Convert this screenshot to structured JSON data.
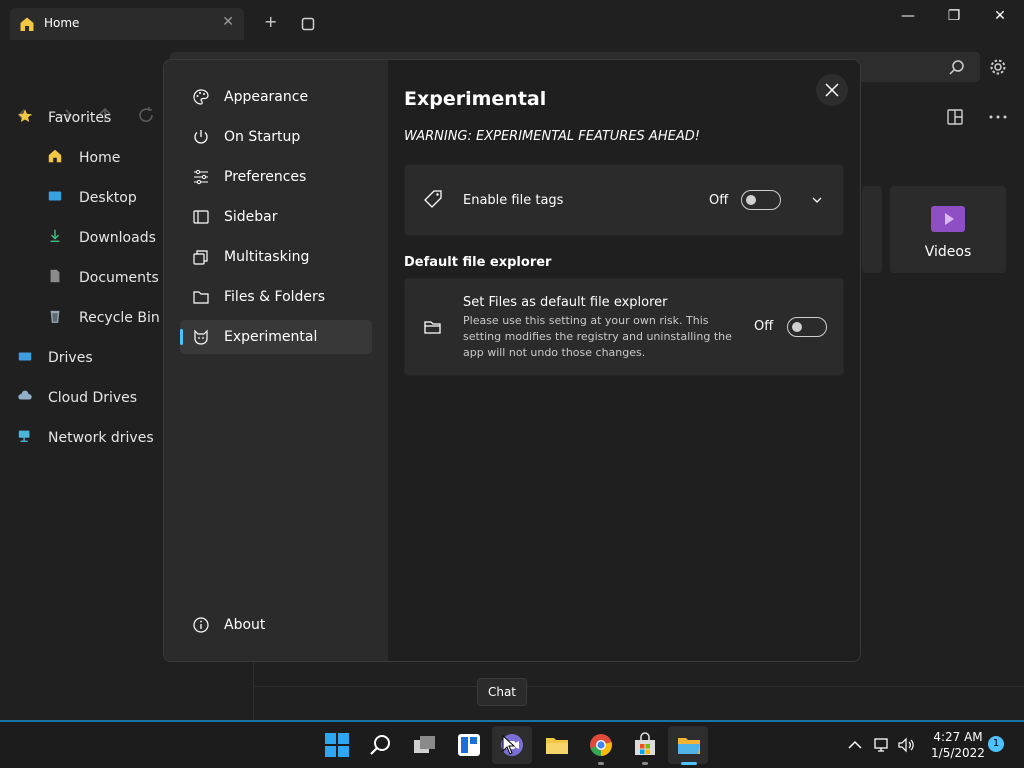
{
  "window": {
    "tab_title": "Home",
    "tab_close": "✕",
    "new_tab": "+",
    "minimize": "—",
    "maximize": "❐",
    "close": "✕"
  },
  "sidebar": {
    "items": [
      {
        "label": "Favorites",
        "icon": "star-icon",
        "color": "#f2c744"
      },
      {
        "label": "Home",
        "icon": "home-icon",
        "color": "#f2c744"
      },
      {
        "label": "Desktop",
        "icon": "desktop-icon",
        "color": "#3aa0e0"
      },
      {
        "label": "Downloads",
        "icon": "download-icon",
        "color": "#3fbf7f"
      },
      {
        "label": "Documents",
        "icon": "document-icon",
        "color": "#8a8a8a"
      },
      {
        "label": "Recycle Bin",
        "icon": "recycle-bin-icon",
        "color": "#9aa7b2"
      },
      {
        "label": "Drives",
        "icon": "drive-icon",
        "color": "#3aa0e0"
      },
      {
        "label": "Cloud Drives",
        "icon": "cloud-icon",
        "color": "#8fb0c8"
      },
      {
        "label": "Network drives",
        "icon": "network-icon",
        "color": "#4fb3d8"
      }
    ]
  },
  "main": {
    "videos_label": "Videos"
  },
  "settings": {
    "nav": [
      {
        "label": "Appearance",
        "icon": "palette-icon"
      },
      {
        "label": "On Startup",
        "icon": "power-icon"
      },
      {
        "label": "Preferences",
        "icon": "sliders-icon"
      },
      {
        "label": "Sidebar",
        "icon": "sidebar-icon"
      },
      {
        "label": "Multitasking",
        "icon": "multitasking-icon"
      },
      {
        "label": "Files & Folders",
        "icon": "folder-icon"
      },
      {
        "label": "Experimental",
        "icon": "cat-icon",
        "selected": true
      }
    ],
    "about": "About",
    "title": "Experimental",
    "warning": "WARNING: EXPERIMENTAL FEATURES AHEAD!",
    "file_tags": {
      "label": "Enable file tags",
      "state": "Off"
    },
    "section_default": "Default file explorer",
    "default_explorer": {
      "label": "Set Files as default file explorer",
      "description": "Please use this setting at your own risk. This setting modifies the registry and uninstalling the app will not undo those changes.",
      "state": "Off"
    },
    "accent": "#4cc2ff"
  },
  "tooltip": "Chat",
  "taskbar": {
    "time": "4:27 AM",
    "date": "1/5/2022",
    "notification_count": "1"
  }
}
